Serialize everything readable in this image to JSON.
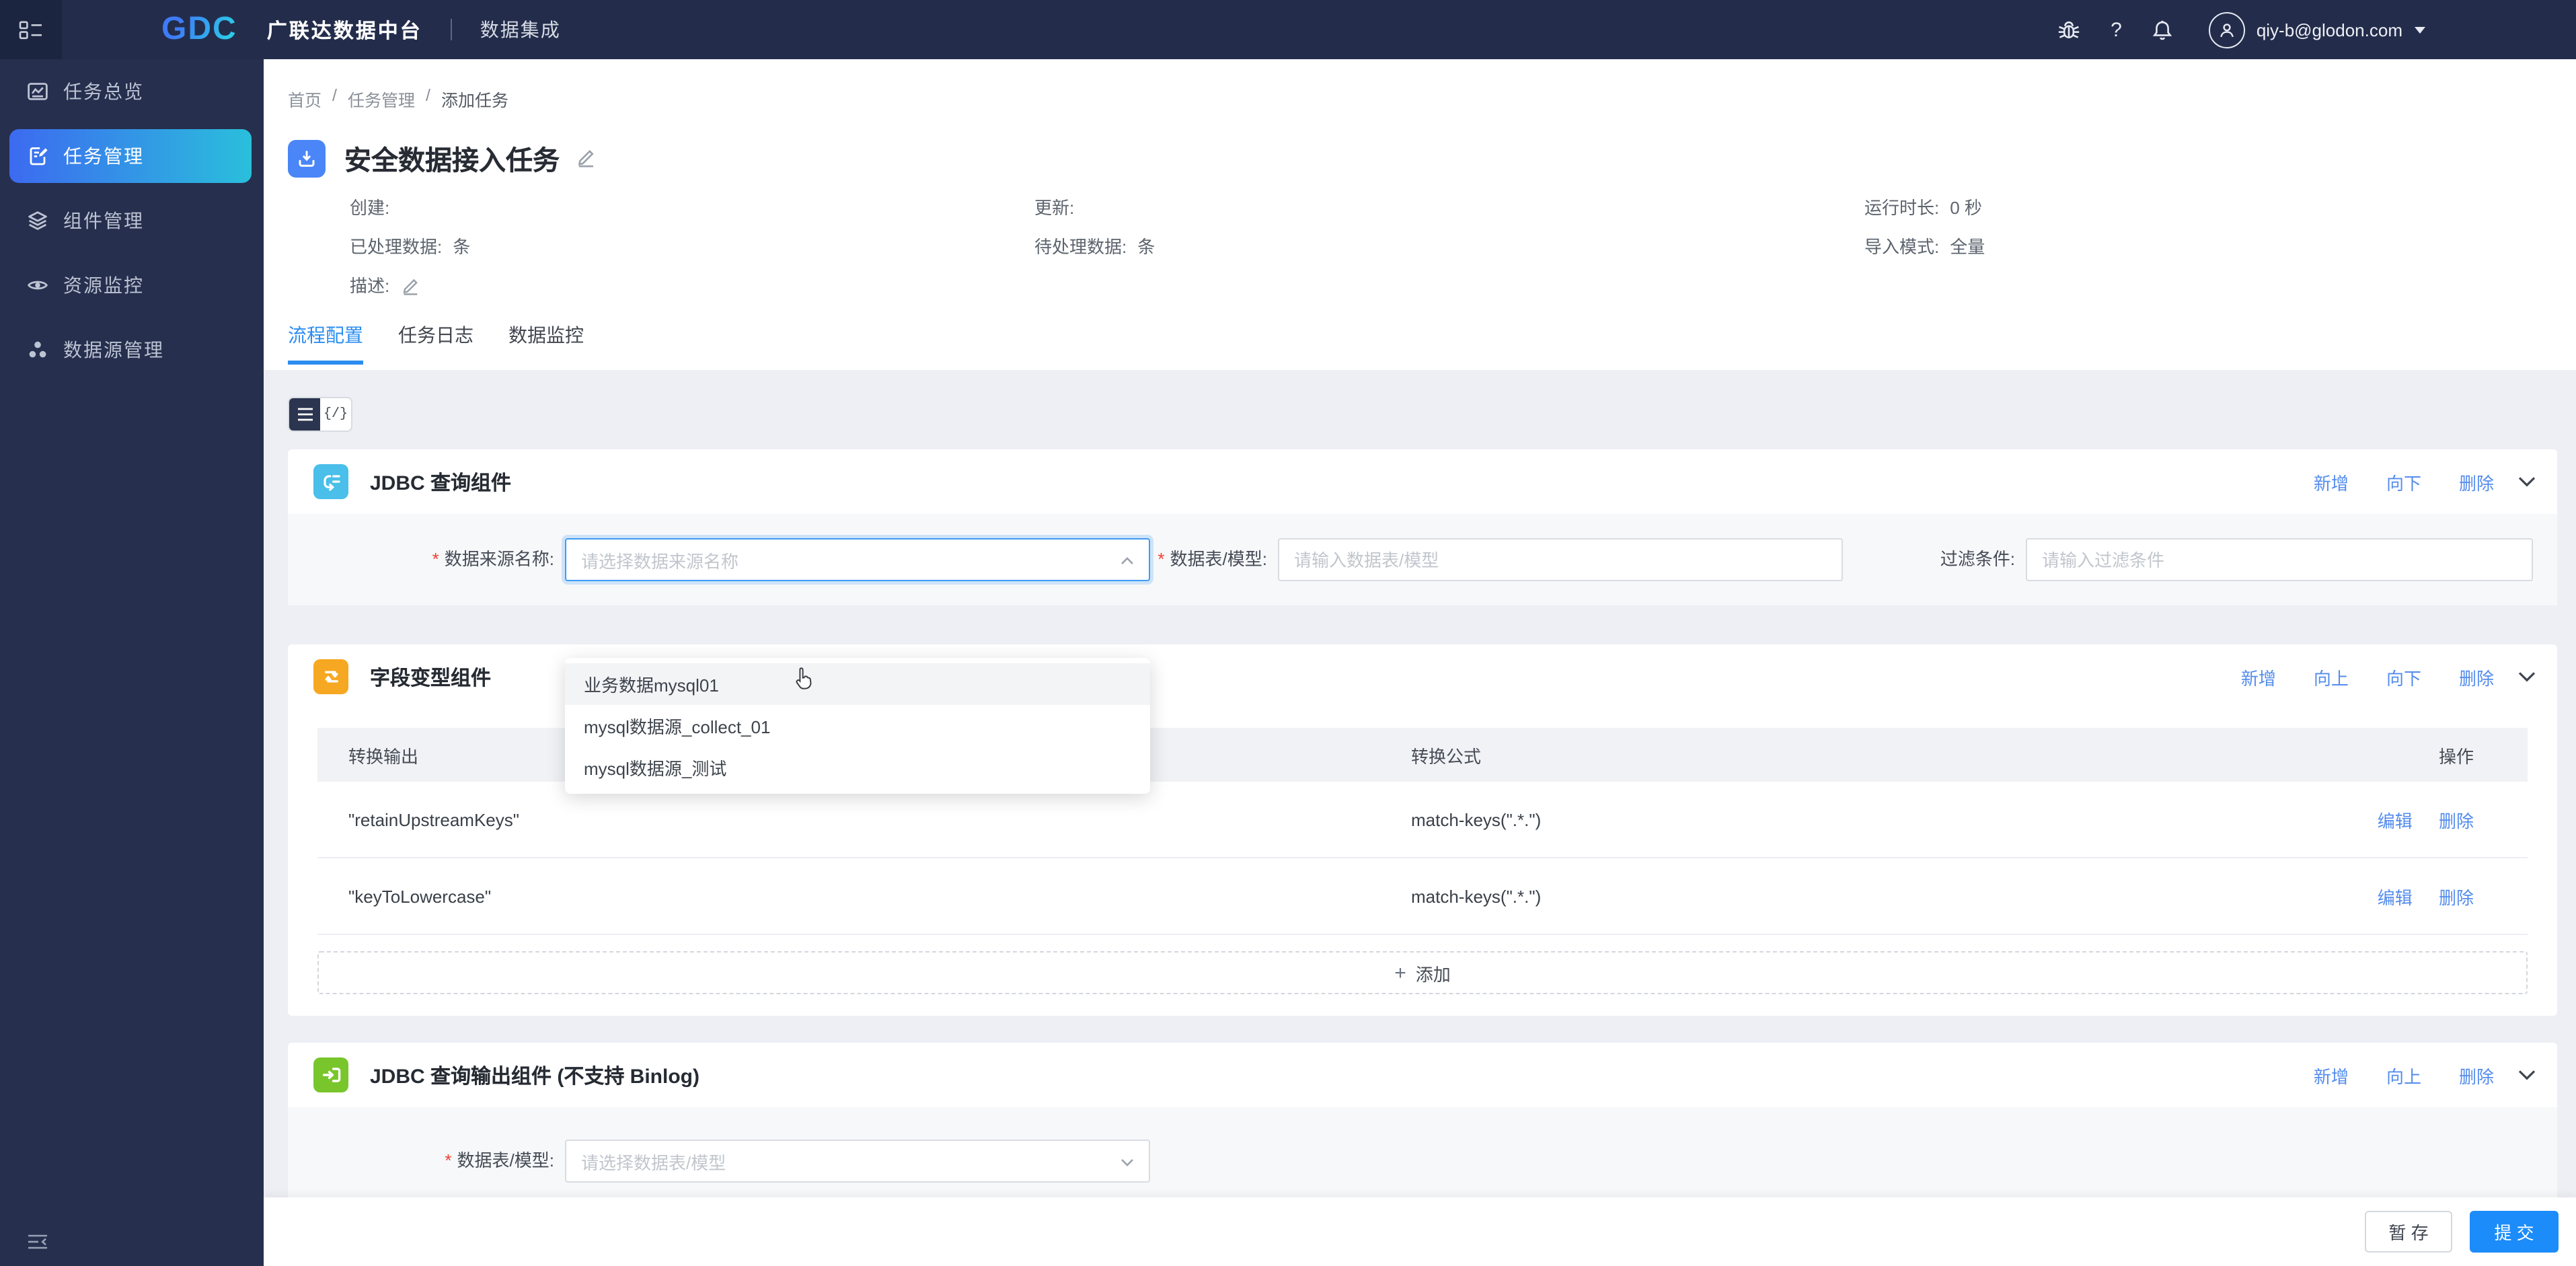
{
  "header": {
    "brand_logo": "GDC",
    "brand_title": "广联达数据中台",
    "nav_item": "数据集成",
    "help_glyph": "?",
    "user_email": "qiy-b@glodon.com"
  },
  "sidebar": {
    "items": [
      {
        "label": "任务总览"
      },
      {
        "label": "任务管理"
      },
      {
        "label": "组件管理"
      },
      {
        "label": "资源监控"
      },
      {
        "label": "数据源管理"
      }
    ]
  },
  "breadcrumb": {
    "items": [
      "首页",
      "任务管理",
      "添加任务"
    ],
    "separator": "/"
  },
  "task": {
    "title": "安全数据接入任务",
    "info": {
      "created_label": "创建:",
      "updated_label": "更新:",
      "runtime_label": "运行时长:",
      "runtime_value": "0 秒",
      "processed_label": "已处理数据:",
      "processed_value": "条",
      "pending_label": "待处理数据:",
      "pending_value": "条",
      "import_mode_label": "导入模式:",
      "import_mode_value": "全量",
      "description_label": "描述:"
    }
  },
  "tabs": [
    {
      "label": "流程配置"
    },
    {
      "label": "任务日志"
    },
    {
      "label": "数据监控"
    }
  ],
  "view_toggle": {
    "json_glyph": "{/}"
  },
  "required_mark": "*",
  "cards": [
    {
      "title": "JDBC 查询组件",
      "actions": [
        "新增",
        "向下",
        "删除"
      ],
      "form": {
        "source_label": "数据来源名称:",
        "source_placeholder": "请选择数据来源名称",
        "table_label": "数据表/模型:",
        "table_placeholder": "请输入数据表/模型",
        "filter_label": "过滤条件:",
        "filter_placeholder": "请输入过滤条件"
      },
      "dropdown_options": [
        "业务数据mysql01",
        "mysql数据源_collect_01",
        "mysql数据源_测试"
      ]
    },
    {
      "title": "字段变型组件",
      "actions": [
        "新增",
        "向上",
        "向下",
        "删除"
      ],
      "table": {
        "columns": [
          "转换输出",
          "转换公式",
          "操作"
        ],
        "rows": [
          {
            "output": "\"retainUpstreamKeys\"",
            "formula": "match-keys(\".*.\")",
            "actions": [
              "编辑",
              "删除"
            ]
          },
          {
            "output": "\"keyToLowercase\"",
            "formula": "match-keys(\".*.\")",
            "actions": [
              "编辑",
              "删除"
            ]
          }
        ],
        "add_label": "添加",
        "plus_glyph": "+"
      }
    },
    {
      "title": "JDBC 查询输出组件 (不支持 Binlog)",
      "actions": [
        "新增",
        "向上",
        "删除"
      ],
      "form": {
        "table_label": "数据表/模型:",
        "table_placeholder": "请选择数据表/模型"
      }
    }
  ],
  "footer": {
    "save_draft": "暂 存",
    "submit": "提 交"
  },
  "colors": {
    "accent": "#1b8cfa",
    "link": "#548ced",
    "sidebar_active_from": "#3c6af0",
    "sidebar_active_to": "#2abfdc",
    "required": "#f04134"
  }
}
